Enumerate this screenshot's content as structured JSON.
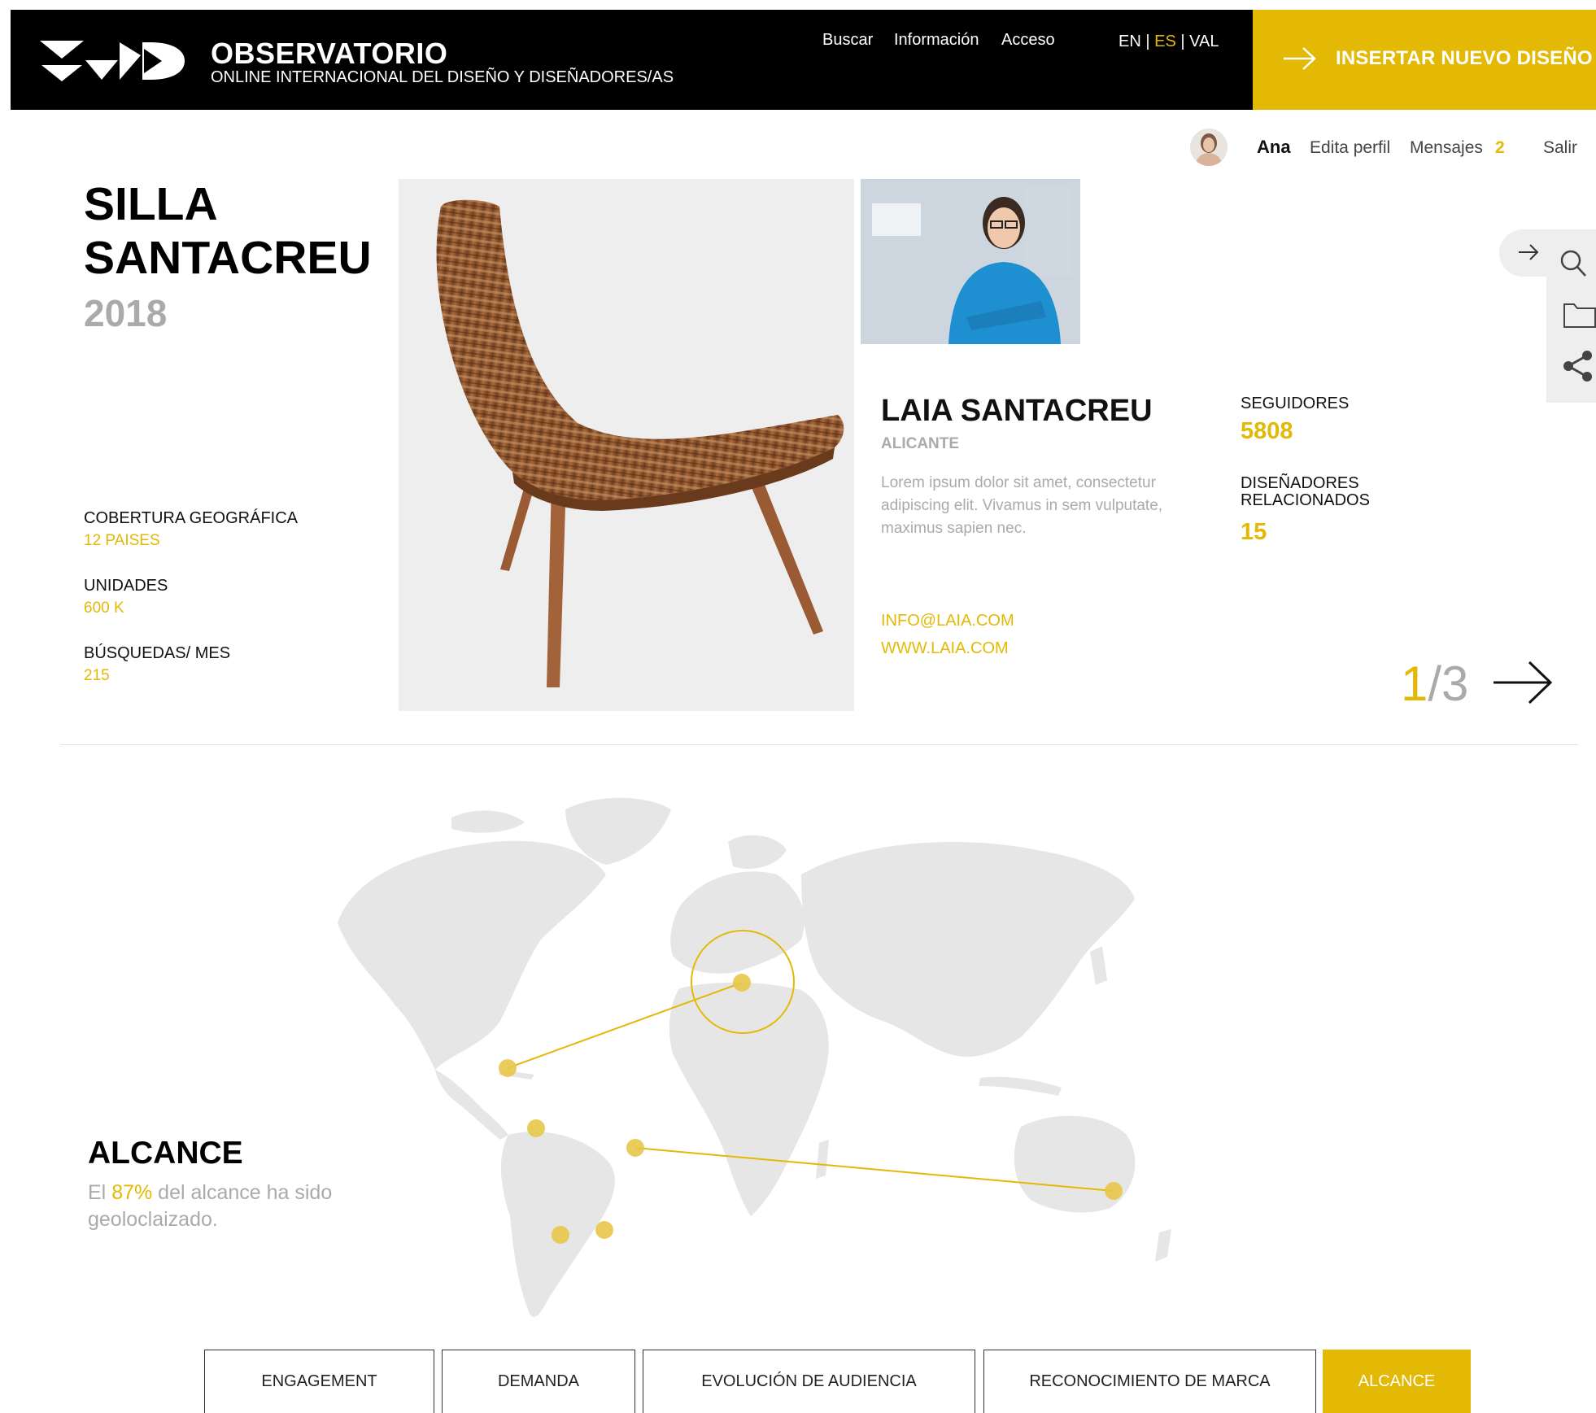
{
  "header": {
    "brand_title": "OBSERVATORIO",
    "brand_subtitle": "ONLINE INTERNACIONAL DEL DISEÑO Y DISEÑADORES/AS",
    "nav": [
      "Buscar",
      "Información",
      "Acceso"
    ],
    "languages": {
      "en": "EN",
      "es": "ES",
      "val": "VAL",
      "separator": "|",
      "active": "ES"
    },
    "cta_label": "INSERTAR NUEVO DISEÑO"
  },
  "user_bar": {
    "name": "Ana",
    "edit_profile": "Edita perfil",
    "messages_label": "Mensajes",
    "messages_count": "2",
    "logout": "Salir"
  },
  "design": {
    "title_line1": "SILLA",
    "title_line2": "SANTACREU",
    "year": "2018",
    "stats": [
      {
        "label": "COBERTURA GEOGRÁFICA",
        "value": "12 PAISES"
      },
      {
        "label": "UNIDADES",
        "value": "600 K"
      },
      {
        "label": "BÚSQUEDAS/ MES",
        "value": "215"
      }
    ]
  },
  "designer": {
    "name": "LAIA SANTACREU",
    "city": "ALICANTE",
    "bio": "Lorem ipsum dolor sit amet, consectetur adipiscing elit. Vivamus in sem vulputate, maximus sapien nec.",
    "email": "INFO@LAIA.COM",
    "web": "WWW.LAIA.COM",
    "followers_label": "SEGUIDORES",
    "followers_value": "5808",
    "related_label_line1": "DISEÑADORES",
    "related_label_line2": "RELACIONADOS",
    "related_value": "15"
  },
  "pager": {
    "current": "1",
    "separator": "/",
    "total": "3"
  },
  "reach": {
    "title": "ALCANCE",
    "text_prefix": "El ",
    "percent": "87%",
    "text_suffix": " del alcance ha sido geoloclaizado."
  },
  "tabs": [
    {
      "label": "ENGAGEMENT",
      "active": false
    },
    {
      "label": "DEMANDA",
      "active": false
    },
    {
      "label": "EVOLUCIÓN DE AUDIENCIA",
      "active": false
    },
    {
      "label": "RECONOCIMIENTO DE MARCA",
      "active": false
    },
    {
      "label": "ALCANCE",
      "active": true
    }
  ],
  "icons": [
    "arrow-right-icon",
    "search-icon",
    "folder-icon",
    "share-icon"
  ],
  "colors": {
    "accent": "#E3B905",
    "header_bg": "#000000",
    "muted": "#aaaaaa",
    "map_land": "#e6e6e6"
  }
}
